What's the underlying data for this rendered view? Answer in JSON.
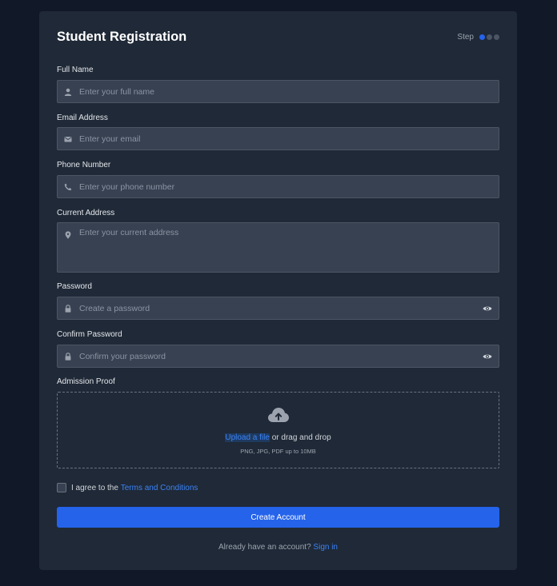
{
  "form": {
    "title": "Student Registration",
    "step_label": "Step",
    "steps_total": 3,
    "steps_current": 1
  },
  "fields": {
    "full_name": {
      "label": "Full Name",
      "placeholder": "Enter your full name",
      "icon": "user-icon"
    },
    "email": {
      "label": "Email Address",
      "placeholder": "Enter your email",
      "icon": "envelope-icon"
    },
    "phone": {
      "label": "Phone Number",
      "placeholder": "Enter your phone number",
      "icon": "phone-icon"
    },
    "address": {
      "label": "Current Address",
      "placeholder": "Enter your current address",
      "icon": "map-pin-icon"
    },
    "password": {
      "label": "Password",
      "placeholder": "Create a password",
      "icon": "lock-icon",
      "toggle_icon": "eye-icon"
    },
    "confirm_password": {
      "label": "Confirm Password",
      "placeholder": "Confirm your password",
      "icon": "lock-icon",
      "toggle_icon": "eye-icon"
    }
  },
  "upload": {
    "label": "Admission Proof",
    "icon": "cloud-upload-icon",
    "link_text": "Upload a file",
    "drag_text": " or drag and drop",
    "hint": "PNG, JPG, PDF up to 10MB"
  },
  "terms": {
    "prefix": "I agree to the ",
    "link_text": "Terms and Conditions"
  },
  "submit_label": "Create Account",
  "signin": {
    "prefix": "Already have an account? ",
    "link_text": "Sign in"
  },
  "colors": {
    "background": "#111827",
    "card": "#1f2937",
    "input": "#374151",
    "accent": "#2563eb",
    "link": "#3b82f6"
  }
}
